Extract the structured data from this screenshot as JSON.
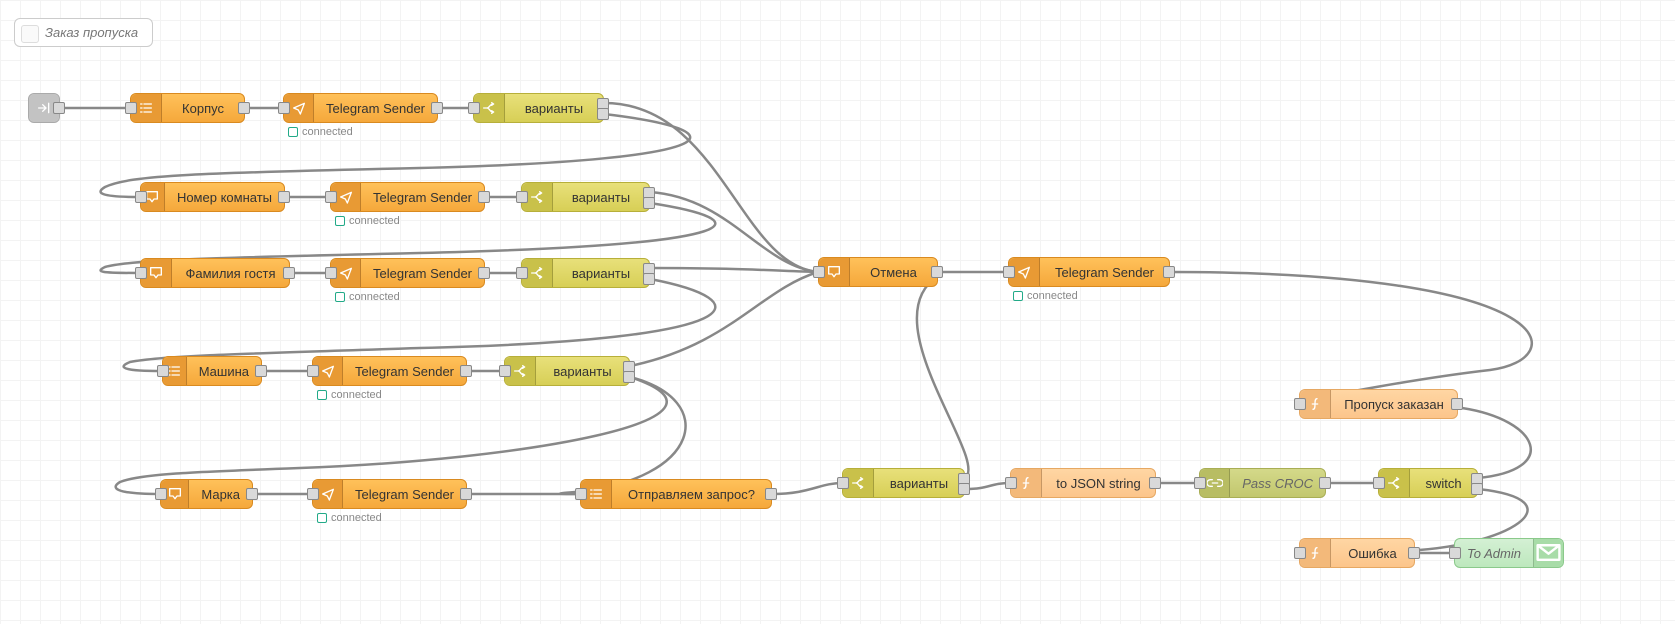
{
  "subflow_title": "Заказ пропуска",
  "status_connected": "connected",
  "nodes": {
    "korpus": "Корпус",
    "telegram_sender": "Telegram Sender",
    "variants": "варианты",
    "nomer_komnaty": "Номер комнаты",
    "familiya_gostya": "Фамилия гостя",
    "mashina": "Машина",
    "marka": "Марка",
    "otpravlyaem_zapros": "Отправляем запрос?",
    "otmena": "Отмена",
    "to_json_string": "to JSON string",
    "pass_croc": "Pass CROC",
    "switch": "switch",
    "propusk_zakazan": "Пропуск заказан",
    "oshibka": "Ошибка",
    "to_admin": "To Admin"
  },
  "colors": {
    "orange": "#f5a83b",
    "yellow": "#d7cf56",
    "peach": "#fcc58b",
    "olive": "#c2c76e",
    "mint": "#bde8bd"
  }
}
